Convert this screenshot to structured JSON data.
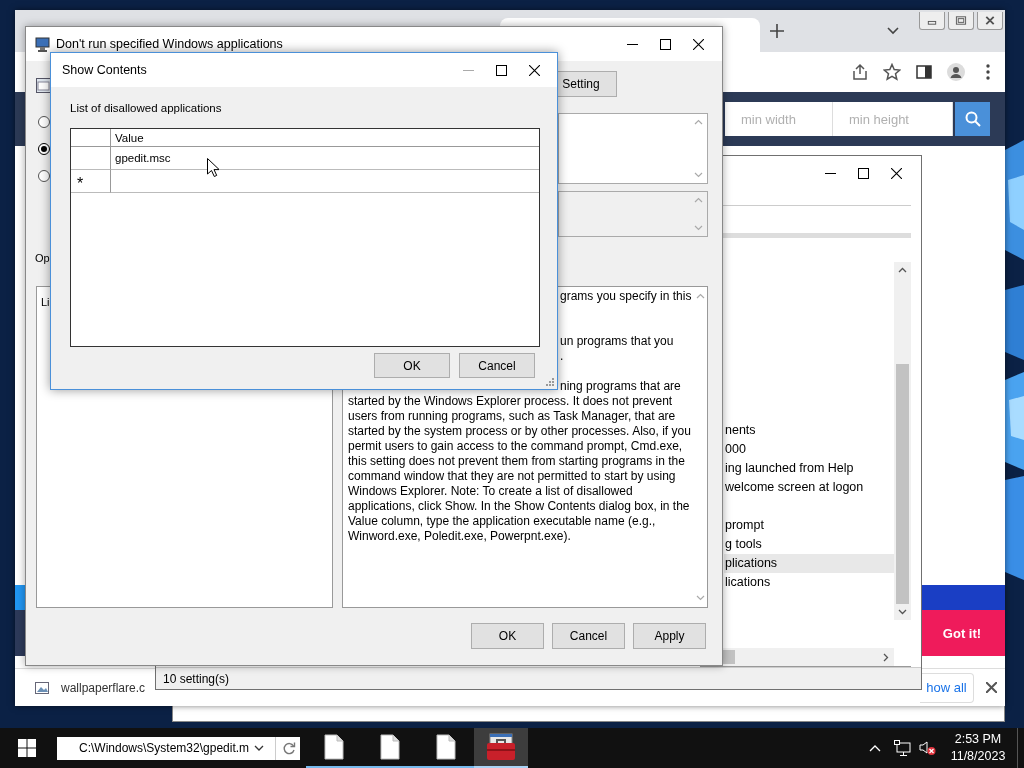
{
  "browser": {
    "search_fields": [
      {
        "placeholder": "min width"
      },
      {
        "placeholder": "min height"
      }
    ],
    "cookie_button": "Got it!",
    "download": {
      "file_name": "wallpaperflare.c",
      "show_all": "how all"
    }
  },
  "editor": {
    "rows": [
      {
        "text": "nents",
        "selected": false
      },
      {
        "text": "000",
        "selected": false
      },
      {
        "text": "ing launched from Help",
        "selected": false
      },
      {
        "text": "welcome screen at logon",
        "selected": false
      },
      {
        "text": "prompt",
        "selected": false
      },
      {
        "text": "g tools",
        "selected": false
      },
      {
        "text": "plications",
        "selected": true
      },
      {
        "text": "lications",
        "selected": false
      }
    ],
    "status": "10 setting(s)"
  },
  "policy_dialog": {
    "title": "Don't run specified Windows applications",
    "nav_button": "Setting",
    "state_options": [
      {
        "selected": false
      },
      {
        "selected": true
      },
      {
        "selected": false
      }
    ],
    "options_label": "Op",
    "list_label": "Li",
    "help_fragments": [
      "grams you specify in this",
      "un programs that you",
      ".",
      "ning programs that are"
    ],
    "help_text": "started by the Windows Explorer process. It does not prevent users from running programs, such as Task Manager, that are started by the system process or by other processes. Also, if you permit users to gain access to the command prompt, Cmd.exe, this setting does not prevent them from starting programs in the command window that they are not permitted to start by using Windows Explorer. Note: To create a list of disallowed applications, click Show. In the Show Contents dialog box, in the Value column, type the application executable name (e.g., Winword.exe, Poledit.exe, Powerpnt.exe).",
    "buttons": [
      "OK",
      "Cancel",
      "Apply"
    ]
  },
  "show_contents": {
    "title": "Show Contents",
    "label": "List of disallowed applications",
    "column": "Value",
    "rows": [
      {
        "value": "gpedit.msc"
      }
    ],
    "new_row_marker": "*",
    "buttons": [
      "OK",
      "Cancel"
    ]
  },
  "taskbar": {
    "address": "C:\\Windows\\System32\\gpedit.m",
    "apps": [
      {
        "kind": "file",
        "selected": false
      },
      {
        "kind": "file",
        "selected": false
      },
      {
        "kind": "file",
        "selected": false
      },
      {
        "kind": "toolbox",
        "selected": true
      }
    ],
    "time": "2:53 PM",
    "date": "11/8/2023"
  }
}
